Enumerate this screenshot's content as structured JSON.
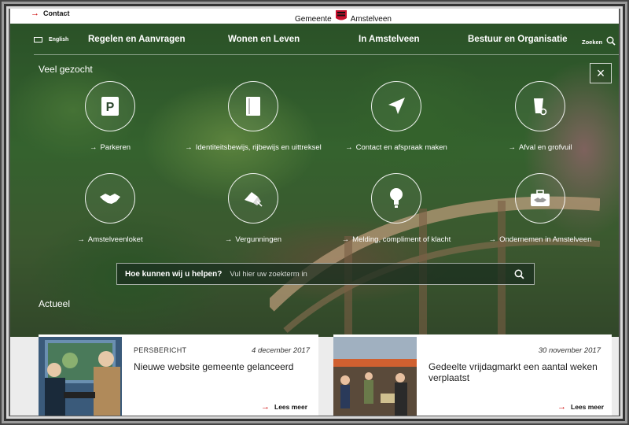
{
  "topbar": {
    "contact_label": "Contact",
    "brand_left": "Gemeente",
    "brand_right": "Amstelveen"
  },
  "nav": {
    "language": "English",
    "items": [
      {
        "label": "Regelen en Aanvragen"
      },
      {
        "label": "Wonen en Leven"
      },
      {
        "label": "In Amstelveen"
      },
      {
        "label": "Bestuur en Organisatie"
      }
    ],
    "search_label": "Zoeken"
  },
  "popular": {
    "title": "Veel gezocht",
    "tiles": [
      {
        "label": "Parkeren",
        "icon": "parking-icon"
      },
      {
        "label": "Identiteitsbewijs, rijbewijs en uittreksel",
        "icon": "document-icon"
      },
      {
        "label": "Contact en afspraak maken",
        "icon": "navigation-arrow-icon"
      },
      {
        "label": "Afval en grofvuil",
        "icon": "waste-bin-icon"
      },
      {
        "label": "Amstelveenloket",
        "icon": "handshake-icon"
      },
      {
        "label": "Vergunningen",
        "icon": "permit-icon"
      },
      {
        "label": "Melding, compliment of klacht",
        "icon": "lightbulb-icon"
      },
      {
        "label": "Ondernemen in Amstelveen",
        "icon": "briefcase-icon"
      }
    ]
  },
  "search": {
    "label": "Hoe kunnen wij u helpen?",
    "placeholder": "Vul hier uw zoekterm in"
  },
  "news": {
    "title": "Actueel",
    "cards": [
      {
        "type": "PERSBERICHT",
        "date": "4 december 2017",
        "title": "Nieuwe website gemeente gelanceerd",
        "more": "Lees meer"
      },
      {
        "type": "",
        "date": "30 november 2017",
        "title": "Gedeelte vrijdagmarkt een aantal weken verplaatst",
        "more": "Lees meer"
      }
    ]
  },
  "colors": {
    "accent": "#cc0000",
    "overlay": "#1f3a24"
  }
}
